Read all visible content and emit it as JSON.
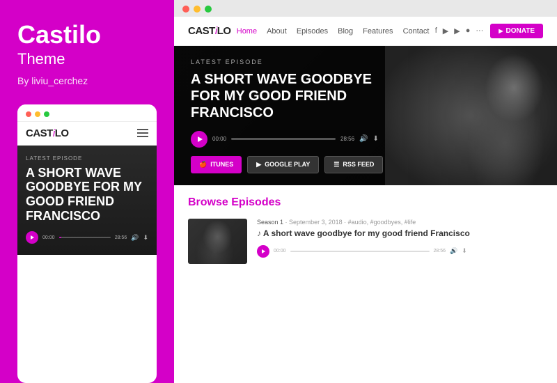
{
  "left": {
    "title": "Castilo",
    "subtitle": "Theme",
    "author": "By liviu_cerchez",
    "mobile": {
      "dots": [
        "red",
        "yellow",
        "green"
      ],
      "logo": "CAST",
      "logo_symbol": "i",
      "logo_suffix": "LO",
      "latest_label": "LATEST EPISODE",
      "episode_title": "A SHORT WAVE GOODBYE FOR MY GOOD FRIEND FRANCISCO",
      "time_start": "00:00",
      "time_end": "28:56"
    }
  },
  "right": {
    "browser_dots": [
      "r",
      "y",
      "g"
    ],
    "nav": {
      "logo": "CAST",
      "logo_symbol": "i",
      "logo_suffix": "LO",
      "links": [
        "Home",
        "About",
        "Episodes",
        "Blog",
        "Features",
        "Contact"
      ],
      "active_link": "Home",
      "donate_label": "DONATE"
    },
    "hero": {
      "latest_label": "LATEST EPISODE",
      "title": "A SHORT WAVE GOODBYE FOR MY GOOD FRIEND FRANCISCO",
      "time_start": "00:00",
      "time_end": "28:56",
      "buttons": [
        {
          "label": "ITUNES",
          "type": "itunes",
          "icon": "🍎"
        },
        {
          "label": "GOOGLE PLAY",
          "type": "google",
          "icon": "▶"
        },
        {
          "label": "RSS FEED",
          "type": "rss",
          "icon": "☰"
        }
      ]
    },
    "browse": {
      "heading": "Browse",
      "heading_highlight": "Episodes",
      "episode": {
        "season": "Season 1",
        "date": "September 3, 2018",
        "tags": "#audio, #goodbyes, #life",
        "title": "A short wave goodbye for my good friend Francisco",
        "time_start": "00:00",
        "time_end": "28:56"
      }
    }
  }
}
